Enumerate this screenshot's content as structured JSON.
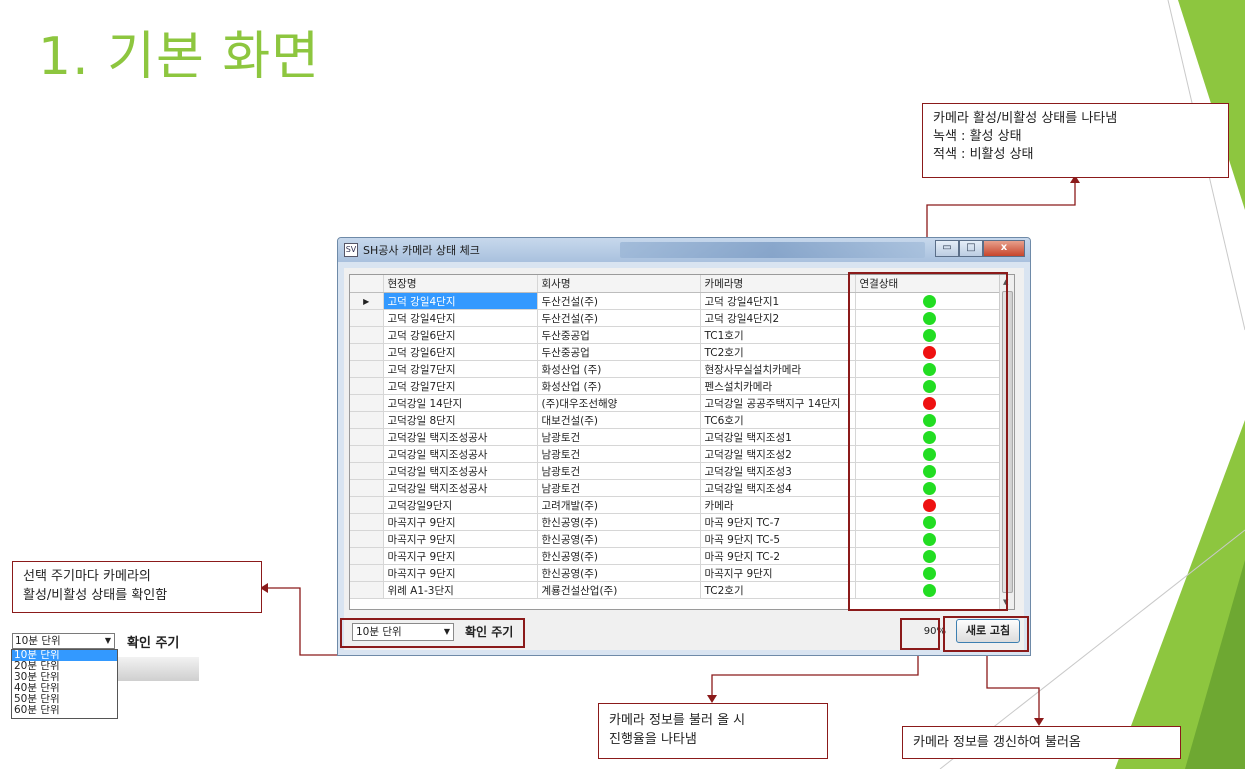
{
  "slide": {
    "title": "1. 기본 화면"
  },
  "callouts": {
    "status": [
      "카메라 활성/비활성 상태를 나타냄",
      "녹색 : 활성 상태",
      "적색 : 비활성 상태"
    ],
    "cycle": [
      "선택 주기마다 카메라의",
      "활성/비활성 상태를 확인함"
    ],
    "progress": [
      "카메라 정보를 불러 올 시",
      "진행율을 나타냄"
    ],
    "refresh": [
      "카메라 정보를 갱신하여 불러옴"
    ]
  },
  "window": {
    "title": "SH공사 카메라 상태 체크",
    "icon_label": "SV",
    "buttons": {
      "min": "▭",
      "max": "□",
      "close": "x"
    },
    "columns": [
      "현장명",
      "회사명",
      "카메라명",
      "연결상태"
    ],
    "status_colors": {
      "active": "#22dd22",
      "inactive": "#ee1111"
    },
    "rows": [
      {
        "site": "고덕 강일4단지",
        "company": "두산건설(주)",
        "camera": "고덕 강일4단지1",
        "status": "active"
      },
      {
        "site": "고덕 강일4단지",
        "company": "두산건설(주)",
        "camera": "고덕 강일4단지2",
        "status": "active"
      },
      {
        "site": "고덕 강일6단지",
        "company": "두산중공업",
        "camera": "TC1호기",
        "status": "active"
      },
      {
        "site": "고덕 강일6단지",
        "company": "두산중공업",
        "camera": "TC2호기",
        "status": "inactive"
      },
      {
        "site": "고덕 강일7단지",
        "company": "화성산업 (주)",
        "camera": "현장사무실설치카메라",
        "status": "active"
      },
      {
        "site": "고덕 강일7단지",
        "company": "화성산업 (주)",
        "camera": "펜스설치카메라",
        "status": "active"
      },
      {
        "site": "고덕강일 14단지",
        "company": "(주)대우조선해양",
        "camera": "고덕강일 공공주택지구 14단지",
        "status": "inactive"
      },
      {
        "site": "고덕강일 8단지",
        "company": "대보건설(주)",
        "camera": "TC6호기",
        "status": "active"
      },
      {
        "site": "고덕강일 택지조성공사",
        "company": "남광토건",
        "camera": "고덕강일 택지조성1",
        "status": "active"
      },
      {
        "site": "고덕강일 택지조성공사",
        "company": "남광토건",
        "camera": "고덕강일 택지조성2",
        "status": "active"
      },
      {
        "site": "고덕강일 택지조성공사",
        "company": "남광토건",
        "camera": "고덕강일 택지조성3",
        "status": "active"
      },
      {
        "site": "고덕강일 택지조성공사",
        "company": "남광토건",
        "camera": "고덕강일 택지조성4",
        "status": "active"
      },
      {
        "site": "고덕강일9단지",
        "company": "고려개발(주)",
        "camera": "카메라",
        "status": "inactive"
      },
      {
        "site": "마곡지구 9단지",
        "company": "한신공영(주)",
        "camera": "마곡 9단지 TC-7",
        "status": "active"
      },
      {
        "site": "마곡지구 9단지",
        "company": "한신공영(주)",
        "camera": "마곡 9단지 TC-5",
        "status": "active"
      },
      {
        "site": "마곡지구 9단지",
        "company": "한신공영(주)",
        "camera": "마곡 9단지 TC-2",
        "status": "active"
      },
      {
        "site": "마곡지구 9단지",
        "company": "한신공영(주)",
        "camera": "마곡지구 9단지",
        "status": "active"
      },
      {
        "site": "위례 A1-3단지",
        "company": "계룡건설산업(주)",
        "camera": "TC2호기",
        "status": "active"
      }
    ],
    "interval_select": "10분 단위",
    "interval_label": "확인 주기",
    "progress_text": "90%",
    "refresh_label": "새로 고침"
  },
  "snippet": {
    "selected": "10분 단위",
    "label": "확인 주기",
    "options": [
      "10분 단위",
      "20분 단위",
      "30분 단위",
      "40분 단위",
      "50분 단위",
      "60분 단위"
    ]
  },
  "accent": {
    "title_green": "#8dc63f",
    "callout_border": "#8b1a1a"
  }
}
